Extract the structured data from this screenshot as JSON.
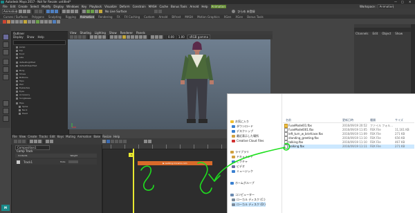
{
  "app": {
    "title": "Autodesk Maya 2017 - Not for Resale: untitled*",
    "window_controls": [
      "—",
      "□",
      "✕"
    ]
  },
  "menubar": {
    "items": [
      "File",
      "Edit",
      "Create",
      "Select",
      "Modify",
      "Display",
      "Windows",
      "Key",
      "Playback",
      "Visualize",
      "Deform",
      "Constrain",
      "MASH",
      "Cache",
      "Bonus Tools",
      "Arnold",
      "Help"
    ],
    "badge": "Animation",
    "workspace_label": "Workspace :",
    "workspace_value": "Animation"
  },
  "statusline": {
    "live_surface": "No Live Surface",
    "user": "ひらめ 未登録"
  },
  "shelf_tabs": {
    "items": [
      "Curves / Surfaces",
      "Polygons",
      "Sculpting",
      "Rigging",
      "Animation",
      "Rendering",
      "FX",
      "FX Caching",
      "Custom",
      "Arnold",
      "Bifrost",
      "MASH",
      "Motion Graphics",
      "XGen",
      "XGen",
      "Bonus Tools"
    ],
    "active_index": 4
  },
  "outliner": {
    "title": "Outliner",
    "menu": [
      "Display",
      "Show",
      "Help"
    ],
    "items": [
      "persp",
      "top",
      "front",
      "side",
      "defaultLightSet",
      "defaultObjectSet",
      "Body",
      "Shoes",
      "Bottoms",
      "Tops",
      "Hair",
      "Eyelashes",
      "Eyes",
      "Accessory",
      "Sunglasses",
      "Hips",
      "Spine",
      "Neck",
      "Head"
    ]
  },
  "viewport": {
    "menu": [
      "View",
      "Shading",
      "Lighting",
      "Show",
      "Renderer",
      "Panels"
    ],
    "color_space": "sRGB gamma",
    "zoom_value": "1.00",
    "exposure_value": "0.00"
  },
  "right_panel": {
    "menu": [
      "Channels",
      "Edit",
      "Object",
      "Show"
    ]
  },
  "time_editor": {
    "menu": [
      "File",
      "View",
      "Create",
      "Tracks",
      "Edit",
      "Keys",
      "Muting",
      "Animation",
      "Bake",
      "Resize",
      "Help"
    ],
    "filter_placeholder": "Composition1",
    "track_header_label": "Comp Track",
    "col_labels": [
      "Contents",
      "Weight"
    ],
    "clip_label": "walking:mixamo.com",
    "playhead_frame": "3",
    "mute_label": "Mute",
    "track_name": "Track1"
  },
  "explorer": {
    "nav": [
      {
        "label": "お気に入り",
        "icon": "star-icon",
        "color": "#f0c030"
      },
      {
        "label": "ダウンロード",
        "icon": "download-icon",
        "color": "#3a80d0"
      },
      {
        "label": "デスクトップ",
        "icon": "desktop-icon",
        "color": "#3a80d0"
      },
      {
        "label": "最近表示した場所",
        "icon": "recent-places-icon",
        "color": "#d0a040"
      },
      {
        "label": "Creative Cloud Files",
        "icon": "creative-cloud-icon",
        "color": "#d03030"
      },
      {
        "label": "ライブラリ",
        "icon": "library-icon",
        "color": "#d0a040"
      },
      {
        "label": "ドキュメント",
        "icon": "documents-icon",
        "color": "#d0a040"
      },
      {
        "label": "ピクチャ",
        "icon": "pictures-icon",
        "color": "#3a80d0"
      },
      {
        "label": "ビデオ",
        "icon": "videos-icon",
        "color": "#6a6aa0"
      },
      {
        "label": "ミュージック",
        "icon": "music-icon",
        "color": "#3a80d0"
      },
      {
        "label": "ホームグループ",
        "icon": "homegroup-icon",
        "color": "#3a80d0"
      },
      {
        "label": "コンピューター",
        "icon": "computer-icon",
        "color": "#6a8ab0"
      },
      {
        "label": "ローカル ディスク (C:)",
        "icon": "disk-icon",
        "color": "#7a8a9a"
      },
      {
        "label": "ローカル ディスク (D:)",
        "icon": "disk-icon",
        "color": "#7a8a9a"
      }
    ],
    "columns": [
      "名前",
      "更新日時",
      "種類",
      "サイズ"
    ],
    "files": [
      {
        "name": "FuseModel01.fbx",
        "date": "2016/09/19 20:52",
        "type": "ファイル フォル...",
        "size": ""
      },
      {
        "name": "FuseModel001.fbx",
        "date": "2016/09/19 11:05",
        "type": "FBX File",
        "size": "11,161 KB"
      },
      {
        "name": "left_turn_w_briefcase.fbx",
        "date": "2016/09/19 11:09",
        "type": "FBX File",
        "size": "271 KB"
      },
      {
        "name": "standing_greeting.fbx",
        "date": "2016/09/19 11:10",
        "type": "FBX File",
        "size": "656 KB"
      },
      {
        "name": "talking.fbx",
        "date": "2016/09/19 11:10",
        "type": "FBX File",
        "size": "467 KB"
      },
      {
        "name": "walking.fbx",
        "date": "2016/09/19 11:11",
        "type": "FBX File",
        "size": "271 KB"
      }
    ],
    "selected_file_index": 5
  },
  "colors": {
    "maya_bg": "#444444",
    "viewport_top": "#6f7f90",
    "clip_orange": "#d96a2a",
    "playhead_yellow": "#e8e830",
    "annotation_green": "#1ee01e",
    "selection_blue": "#cce8ff"
  }
}
